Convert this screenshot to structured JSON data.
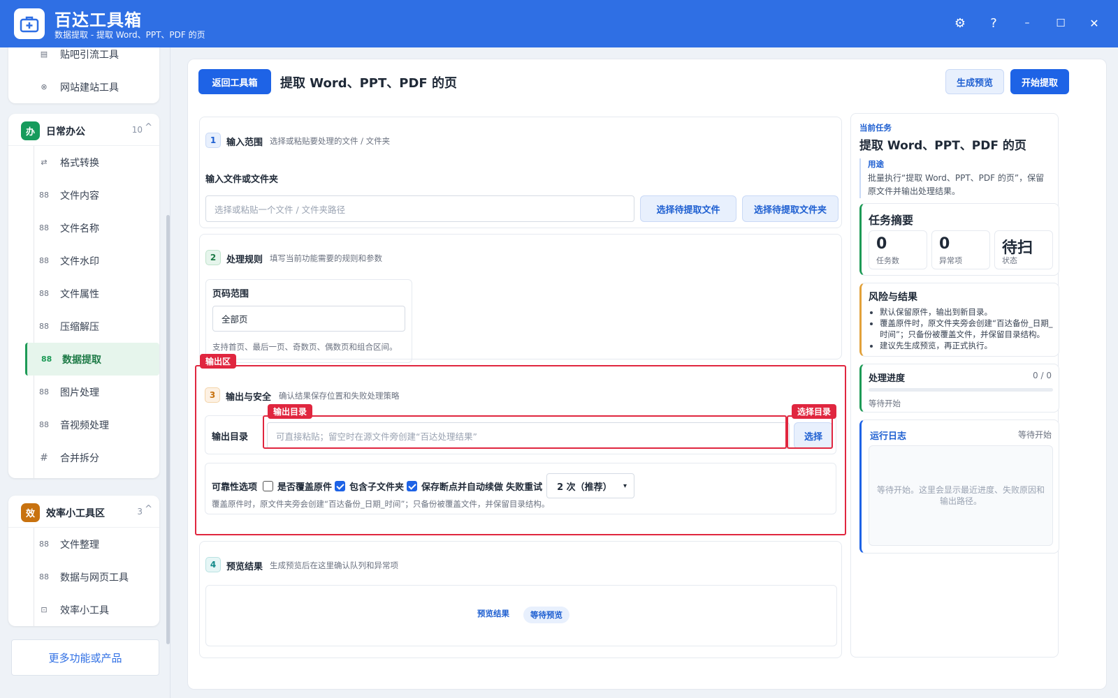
{
  "app": {
    "title": "百达工具箱",
    "subtitle": "数据提取 - 提取 Word、PPT、PDF 的页"
  },
  "window_controls": {
    "settings": "⚙",
    "help": "?",
    "minimize": "–",
    "maximize": "☐",
    "close": "✕"
  },
  "sidebar": {
    "top_items": [
      {
        "label": "贴吧引流工具",
        "icon": "▤"
      },
      {
        "label": "网站建站工具",
        "icon": "⊗"
      }
    ],
    "groups": [
      {
        "badge": "办",
        "title": "日常办公",
        "count": "10",
        "color": "#169b5c",
        "items": [
          {
            "label": "格式转换",
            "icon": "⇄"
          },
          {
            "label": "文件内容",
            "icon": "88"
          },
          {
            "label": "文件名称",
            "icon": "88"
          },
          {
            "label": "文件水印",
            "icon": "88"
          },
          {
            "label": "文件属性",
            "icon": "88"
          },
          {
            "label": "压缩解压",
            "icon": "88"
          },
          {
            "label": "数据提取",
            "icon": "88",
            "active": true
          },
          {
            "label": "图片处理",
            "icon": "88"
          },
          {
            "label": "音视频处理",
            "icon": "88"
          },
          {
            "label": "合并拆分",
            "icon": "#"
          }
        ]
      },
      {
        "badge": "效",
        "title": "效率小工具区",
        "count": "3",
        "color": "#c8720f",
        "items": [
          {
            "label": "文件整理",
            "icon": "88"
          },
          {
            "label": "数据与网页工具",
            "icon": "88"
          },
          {
            "label": "效率小工具",
            "icon": "⊡"
          }
        ]
      }
    ],
    "more_label": "更多功能或产品"
  },
  "header": {
    "back_label": "返回工具箱",
    "title": "提取 Word、PPT、PDF 的页",
    "preview_label": "生成预览",
    "start_label": "开始提取"
  },
  "sections": {
    "input": {
      "num": "1",
      "title": "输入范围",
      "desc": "选择或粘贴要处理的文件 / 文件夹",
      "field_label": "输入文件或文件夹",
      "placeholder": "选择或粘贴一个文件 / 文件夹路径",
      "btn_file": "选择待提取文件",
      "btn_folder": "选择待提取文件夹"
    },
    "rules": {
      "num": "2",
      "title": "处理规则",
      "desc": "填写当前功能需要的规则和参数",
      "field_label": "页码范围",
      "value": "全部页",
      "hint": "支持首页、最后一页、奇数页、偶数页和组合区间。"
    },
    "output": {
      "num": "3",
      "title": "输出与安全",
      "desc": "确认结果保存位置和失败处理策略",
      "dir_label": "输出目录",
      "placeholder": "可直接粘贴；留空时在源文件旁创建“百达处理结果”",
      "choose_label": "选择",
      "reliability_label": "可靠性选项",
      "opt_overwrite": "是否覆盖原件",
      "opt_subfolder": "包含子文件夹",
      "opt_resume": "保存断点并自动续做",
      "retry_label": "失败重试",
      "retry_value": "2 次（推荐）",
      "note": "覆盖原件时，原文件夹旁会创建“百达备份_日期_时间”；只备份被覆盖文件，并保留目录结构。"
    },
    "preview": {
      "num": "4",
      "title": "预览结果",
      "desc": "生成预览后在这里确认队列和异常项",
      "result_label": "预览结果",
      "status_badge": "等待预览"
    }
  },
  "annotations": {
    "output_area": "输出区",
    "output_dir": "输出目录",
    "choose_dir": "选择目录"
  },
  "right_panel": {
    "current_task_label": "当前任务",
    "task_title": "提取 Word、PPT、PDF 的页",
    "purpose_label": "用途",
    "purpose_text": "批量执行“提取 Word、PPT、PDF 的页”，保留原文件并输出处理结果。",
    "summary": {
      "title": "任务摘要",
      "stats": [
        {
          "value": "0",
          "label": "任务数"
        },
        {
          "value": "0",
          "label": "异常项"
        },
        {
          "value": "待扫",
          "label": "状态"
        }
      ]
    },
    "risk": {
      "title": "风险与结果",
      "items": [
        "默认保留原件，输出到新目录。",
        "覆盖原件时，原文件夹旁会创建“百达备份_日期_时间”；只备份被覆盖文件，并保留目录结构。",
        "建议先生成预览，再正式执行。"
      ]
    },
    "progress": {
      "title": "处理进度",
      "count": "0 / 0",
      "status": "等待开始",
      "value": 0
    },
    "log": {
      "title": "运行日志",
      "status": "等待开始",
      "placeholder": "等待开始。这里会显示最近进度、失败原因和输出路径。"
    }
  },
  "colors": {
    "accent": "#1e63e6",
    "titlebar": "#2f6fe4",
    "annotation": "#e0263f",
    "active_green": "#1d9a56",
    "warn_orange": "#e2a13a"
  }
}
